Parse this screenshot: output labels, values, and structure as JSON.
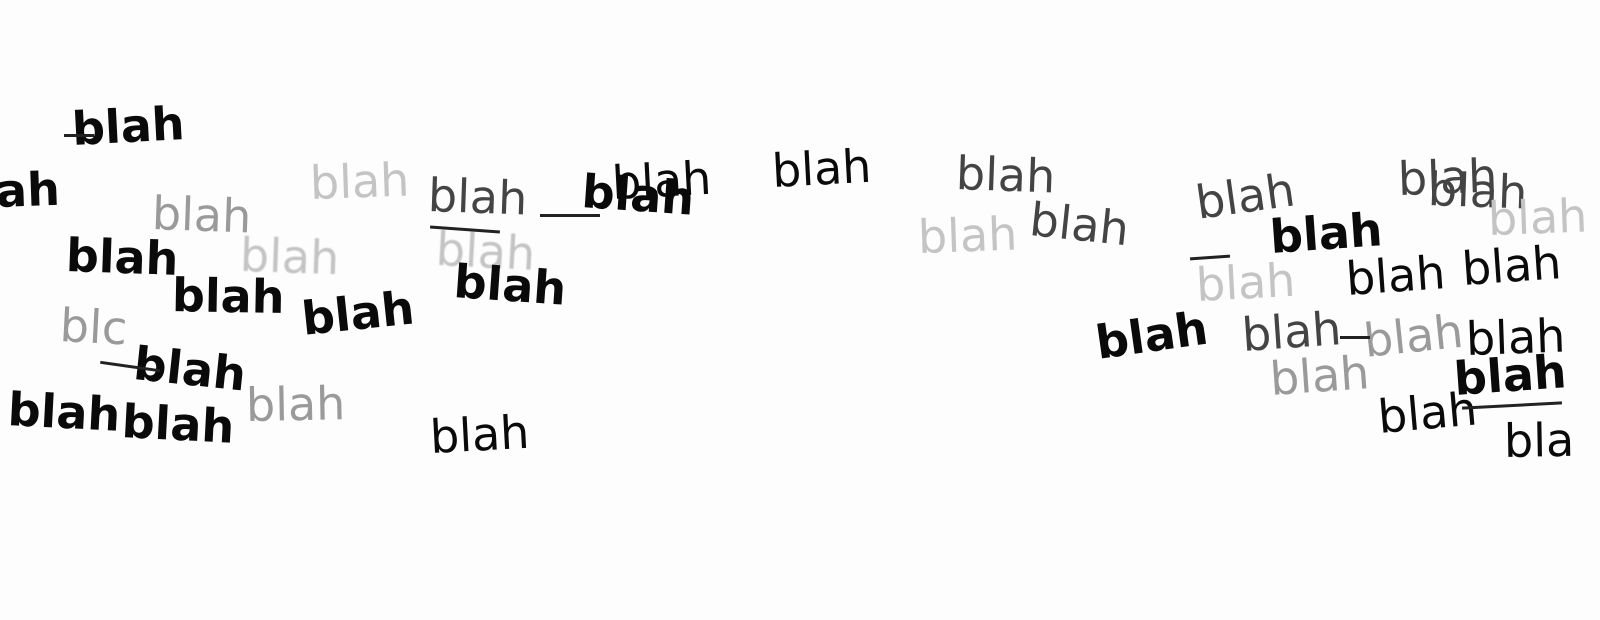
{
  "stamp_word": "blah",
  "partial_words": {
    "left_edge": "ah",
    "right_edge": "bla",
    "faint_left": "blc"
  }
}
